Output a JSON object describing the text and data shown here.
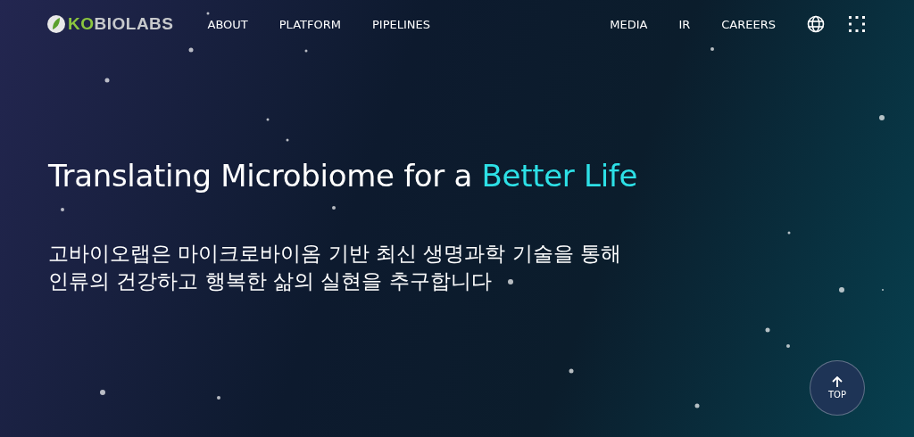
{
  "header": {
    "logo": {
      "accent": "KO",
      "rest": "BIOLABS"
    },
    "nav_left": [
      "ABOUT",
      "PLATFORM",
      "PIPELINES"
    ],
    "nav_right": [
      "MEDIA",
      "IR",
      "CAREERS"
    ]
  },
  "hero": {
    "title": {
      "lead": "Translating Microbiome for a ",
      "highlight": "Better Life"
    },
    "subtitle_lines": [
      "고바이오랩은 마이크로바이옴 기반 최신 생명과학 기술을 통해",
      "인류의 건강하고 행복한 삶의 실현을 추구합니다"
    ]
  },
  "top_button": {
    "label": "TOP"
  }
}
